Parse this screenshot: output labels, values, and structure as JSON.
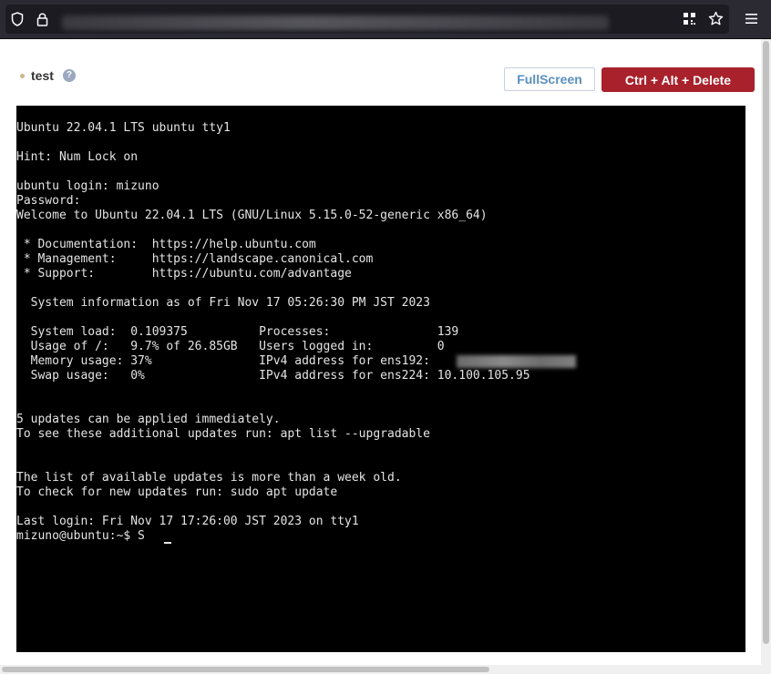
{
  "browser": {
    "icons": [
      "shield-icon",
      "lock-icon",
      "qr-code-icon",
      "bookmark-star-icon",
      "menu-icon"
    ]
  },
  "vm": {
    "name": "test",
    "help_label": "?",
    "status_color": "#c9b98a"
  },
  "buttons": {
    "fullscreen_label": "FullScreen",
    "ctrl_alt_delete_label": "Ctrl + Alt + Delete"
  },
  "colors": {
    "danger": "#a8212b",
    "link": "#5a8fbf",
    "terminal_bg": "#000000"
  },
  "terminal": {
    "lines": [
      "Ubuntu 22.04.1 LTS ubuntu tty1",
      "",
      "Hint: Num Lock on",
      "",
      "ubuntu login: mizuno",
      "Password:",
      "Welcome to Ubuntu 22.04.1 LTS (GNU/Linux 5.15.0-52-generic x86_64)",
      "",
      " * Documentation:  https://help.ubuntu.com",
      " * Management:     https://landscape.canonical.com",
      " * Support:        https://ubuntu.com/advantage",
      "",
      "  System information as of Fri Nov 17 05:26:30 PM JST 2023",
      "",
      "  System load:  0.109375          Processes:               139",
      "  Usage of /:   9.7% of 26.85GB   Users logged in:         0",
      "  Memory usage: 37%               IPv4 address for ens192: ",
      "  Swap usage:   0%                IPv4 address for ens224: 10.100.105.95",
      "",
      "",
      "5 updates can be applied immediately.",
      "To see these additional updates run: apt list --upgradable",
      "",
      "",
      "The list of available updates is more than a week old.",
      "To check for new updates run: sudo apt update",
      "",
      "Last login: Fri Nov 17 17:26:00 JST 2023 on tty1",
      "mizuno@ubuntu:~$ S"
    ]
  }
}
